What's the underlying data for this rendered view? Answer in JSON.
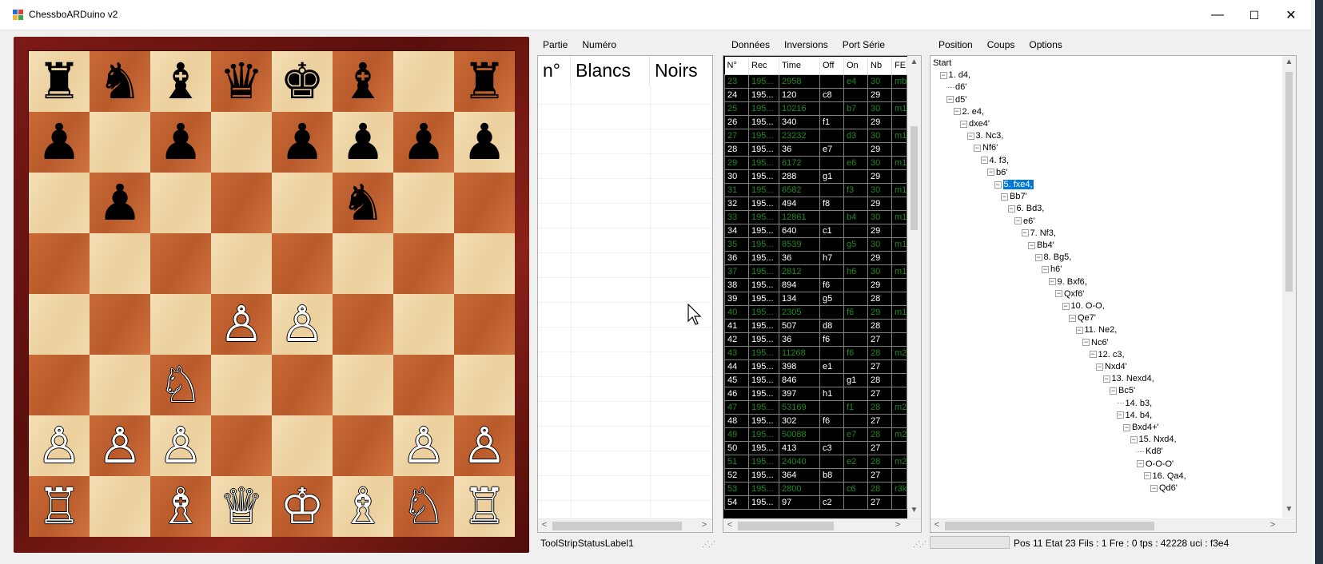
{
  "window": {
    "title": "ChessboARDuino v2",
    "minimize": "—",
    "maximize": "☐",
    "close": "✕"
  },
  "board": {
    "rows": [
      [
        "♜",
        "♞",
        "♝",
        "♛",
        "♚",
        "♝",
        "",
        "♜"
      ],
      [
        "♟",
        "",
        "♟",
        "",
        "♟",
        "♟",
        "♟",
        "♟"
      ],
      [
        "",
        "♟",
        "",
        "",
        "",
        "♞",
        "",
        ""
      ],
      [
        "",
        "",
        "",
        "",
        "",
        "",
        "",
        ""
      ],
      [
        "",
        "",
        "",
        "♙",
        "♙",
        "",
        "",
        ""
      ],
      [
        "",
        "",
        "♘",
        "",
        "",
        "",
        "",
        ""
      ],
      [
        "♙",
        "♙",
        "♙",
        "",
        "",
        "",
        "♙",
        "♙"
      ],
      [
        "♖",
        "",
        "♗",
        "♕",
        "♔",
        "♗",
        "♘",
        "♖"
      ]
    ],
    "colors": {
      "light": "#efd7a8",
      "dark": "#c4652f",
      "frame": "#6e1612"
    }
  },
  "moves_panel": {
    "menu": [
      "Partie",
      "Numéro"
    ],
    "columns": [
      "n°",
      "Blancs",
      "Noirs"
    ]
  },
  "data_panel": {
    "menu": [
      "Données",
      "Inversions",
      "Port Série"
    ],
    "columns": [
      "N°",
      "Rec",
      "Time",
      "Off",
      "On",
      "Nb",
      "FEI"
    ],
    "rows": [
      {
        "c": [
          "23",
          "195...",
          "2958",
          "",
          "e4",
          "30",
          "mb"
        ],
        "g": true
      },
      {
        "c": [
          "24",
          "195...",
          "120",
          "c8",
          "",
          "29",
          ""
        ],
        "g": false
      },
      {
        "c": [
          "25",
          "195...",
          "10216",
          "",
          "b7",
          "30",
          "m1"
        ],
        "g": true
      },
      {
        "c": [
          "26",
          "195...",
          "340",
          "f1",
          "",
          "29",
          ""
        ],
        "g": false
      },
      {
        "c": [
          "27",
          "195...",
          "23232",
          "",
          "d3",
          "30",
          "m1"
        ],
        "g": true
      },
      {
        "c": [
          "28",
          "195...",
          "36",
          "e7",
          "",
          "29",
          ""
        ],
        "g": false
      },
      {
        "c": [
          "29",
          "195...",
          "6172",
          "",
          "e6",
          "30",
          "m1"
        ],
        "g": true
      },
      {
        "c": [
          "30",
          "195...",
          "288",
          "g1",
          "",
          "29",
          ""
        ],
        "g": false
      },
      {
        "c": [
          "31",
          "195...",
          "6582",
          "",
          "f3",
          "30",
          "m1"
        ],
        "g": true
      },
      {
        "c": [
          "32",
          "195...",
          "494",
          "f8",
          "",
          "29",
          ""
        ],
        "g": false
      },
      {
        "c": [
          "33",
          "195...",
          "12861",
          "",
          "b4",
          "30",
          "m1"
        ],
        "g": true
      },
      {
        "c": [
          "34",
          "195...",
          "640",
          "c1",
          "",
          "29",
          ""
        ],
        "g": false
      },
      {
        "c": [
          "35",
          "195...",
          "8539",
          "",
          "g5",
          "30",
          "m1"
        ],
        "g": true
      },
      {
        "c": [
          "36",
          "195...",
          "36",
          "h7",
          "",
          "29",
          ""
        ],
        "g": false
      },
      {
        "c": [
          "37",
          "195...",
          "2812",
          "",
          "h6",
          "30",
          "m1"
        ],
        "g": true
      },
      {
        "c": [
          "38",
          "195...",
          "894",
          "f6",
          "",
          "29",
          ""
        ],
        "g": false
      },
      {
        "c": [
          "39",
          "195...",
          "134",
          "g5",
          "",
          "28",
          ""
        ],
        "g": false
      },
      {
        "c": [
          "40",
          "195...",
          "2305",
          "",
          "f6",
          "29",
          "m1"
        ],
        "g": true
      },
      {
        "c": [
          "41",
          "195...",
          "507",
          "d8",
          "",
          "28",
          ""
        ],
        "g": false
      },
      {
        "c": [
          "42",
          "195...",
          "36",
          "f6",
          "",
          "27",
          ""
        ],
        "g": false
      },
      {
        "c": [
          "43",
          "195...",
          "11268",
          "",
          "f6",
          "28",
          "m2"
        ],
        "g": true
      },
      {
        "c": [
          "44",
          "195...",
          "398",
          "e1",
          "",
          "27",
          ""
        ],
        "g": false
      },
      {
        "c": [
          "45",
          "195...",
          "846",
          "",
          "g1",
          "28",
          ""
        ],
        "g": false
      },
      {
        "c": [
          "46",
          "195...",
          "397",
          "h1",
          "",
          "27",
          ""
        ],
        "g": false
      },
      {
        "c": [
          "47",
          "195...",
          "53169",
          "",
          "f1",
          "28",
          "m2"
        ],
        "g": true
      },
      {
        "c": [
          "48",
          "195...",
          "302",
          "f6",
          "",
          "27",
          ""
        ],
        "g": false
      },
      {
        "c": [
          "49",
          "195...",
          "50088",
          "",
          "e7",
          "28",
          "m2"
        ],
        "g": true
      },
      {
        "c": [
          "50",
          "195...",
          "413",
          "c3",
          "",
          "27",
          ""
        ],
        "g": false
      },
      {
        "c": [
          "51",
          "195...",
          "24040",
          "",
          "e2",
          "28",
          "m2"
        ],
        "g": true
      },
      {
        "c": [
          "52",
          "195...",
          "364",
          "b8",
          "",
          "27",
          ""
        ],
        "g": false
      },
      {
        "c": [
          "53",
          "195...",
          "2800",
          "",
          "c6",
          "28",
          "r3k"
        ],
        "g": true
      },
      {
        "c": [
          "54",
          "195...",
          "97",
          "c2",
          "",
          "27",
          ""
        ],
        "g": false
      }
    ]
  },
  "tree_panel": {
    "menu": [
      "Position",
      "Coups",
      "Options"
    ],
    "nodes": [
      {
        "t": "Start",
        "d": 0,
        "b": "",
        "s": false
      },
      {
        "t": "1. d4,",
        "d": 1,
        "b": "⊟",
        "s": false
      },
      {
        "t": "d6'",
        "d": 2,
        "b": "",
        "s": false
      },
      {
        "t": "d5'",
        "d": 2,
        "b": "⊟",
        "s": false
      },
      {
        "t": "2. e4,",
        "d": 3,
        "b": "⊟",
        "s": false
      },
      {
        "t": "dxe4'",
        "d": 4,
        "b": "⊟",
        "s": false
      },
      {
        "t": "3. Nc3,",
        "d": 5,
        "b": "⊟",
        "s": false
      },
      {
        "t": "Nf6'",
        "d": 6,
        "b": "⊟",
        "s": false
      },
      {
        "t": "4. f3,",
        "d": 7,
        "b": "⊟",
        "s": false
      },
      {
        "t": "b6'",
        "d": 8,
        "b": "⊟",
        "s": false
      },
      {
        "t": "5. fxe4,",
        "d": 9,
        "b": "⊟",
        "s": true
      },
      {
        "t": "Bb7'",
        "d": 10,
        "b": "⊟",
        "s": false
      },
      {
        "t": "6. Bd3,",
        "d": 11,
        "b": "⊟",
        "s": false
      },
      {
        "t": "e6'",
        "d": 12,
        "b": "⊟",
        "s": false
      },
      {
        "t": "7. Nf3,",
        "d": 13,
        "b": "⊟",
        "s": false
      },
      {
        "t": "Bb4'",
        "d": 14,
        "b": "⊟",
        "s": false
      },
      {
        "t": "8. Bg5,",
        "d": 15,
        "b": "⊟",
        "s": false
      },
      {
        "t": "h6'",
        "d": 16,
        "b": "⊟",
        "s": false
      },
      {
        "t": "9. Bxf6,",
        "d": 17,
        "b": "⊟",
        "s": false
      },
      {
        "t": "Qxf6'",
        "d": 18,
        "b": "⊟",
        "s": false
      },
      {
        "t": "10. O-O,",
        "d": 19,
        "b": "⊟",
        "s": false
      },
      {
        "t": "Qe7'",
        "d": 20,
        "b": "⊟",
        "s": false
      },
      {
        "t": "11. Ne2,",
        "d": 21,
        "b": "⊟",
        "s": false
      },
      {
        "t": "Nc6'",
        "d": 22,
        "b": "⊟",
        "s": false
      },
      {
        "t": "12. c3,",
        "d": 23,
        "b": "⊟",
        "s": false
      },
      {
        "t": "Nxd4'",
        "d": 24,
        "b": "⊟",
        "s": false
      },
      {
        "t": "13. Nexd4,",
        "d": 25,
        "b": "⊟",
        "s": false
      },
      {
        "t": "Bc5'",
        "d": 26,
        "b": "⊟",
        "s": false
      },
      {
        "t": "14. b3,",
        "d": 27,
        "b": "",
        "s": false
      },
      {
        "t": "14. b4,",
        "d": 27,
        "b": "⊟",
        "s": false
      },
      {
        "t": "Bxd4+'",
        "d": 28,
        "b": "⊟",
        "s": false
      },
      {
        "t": "15. Nxd4,",
        "d": 29,
        "b": "⊟",
        "s": false
      },
      {
        "t": "Kd8'",
        "d": 30,
        "b": "",
        "s": false
      },
      {
        "t": "O-O-O'",
        "d": 30,
        "b": "⊟",
        "s": false
      },
      {
        "t": "16. Qa4,",
        "d": 31,
        "b": "⊟",
        "s": false
      },
      {
        "t": "Qd6'",
        "d": 32,
        "b": "⊟",
        "s": false
      }
    ]
  },
  "status": {
    "left_label": "ToolStripStatusLabel1",
    "right_label": "Pos 11 Etat 23 Fils : 1 Fre : 0 tps : 42228 uci : f3e4"
  }
}
